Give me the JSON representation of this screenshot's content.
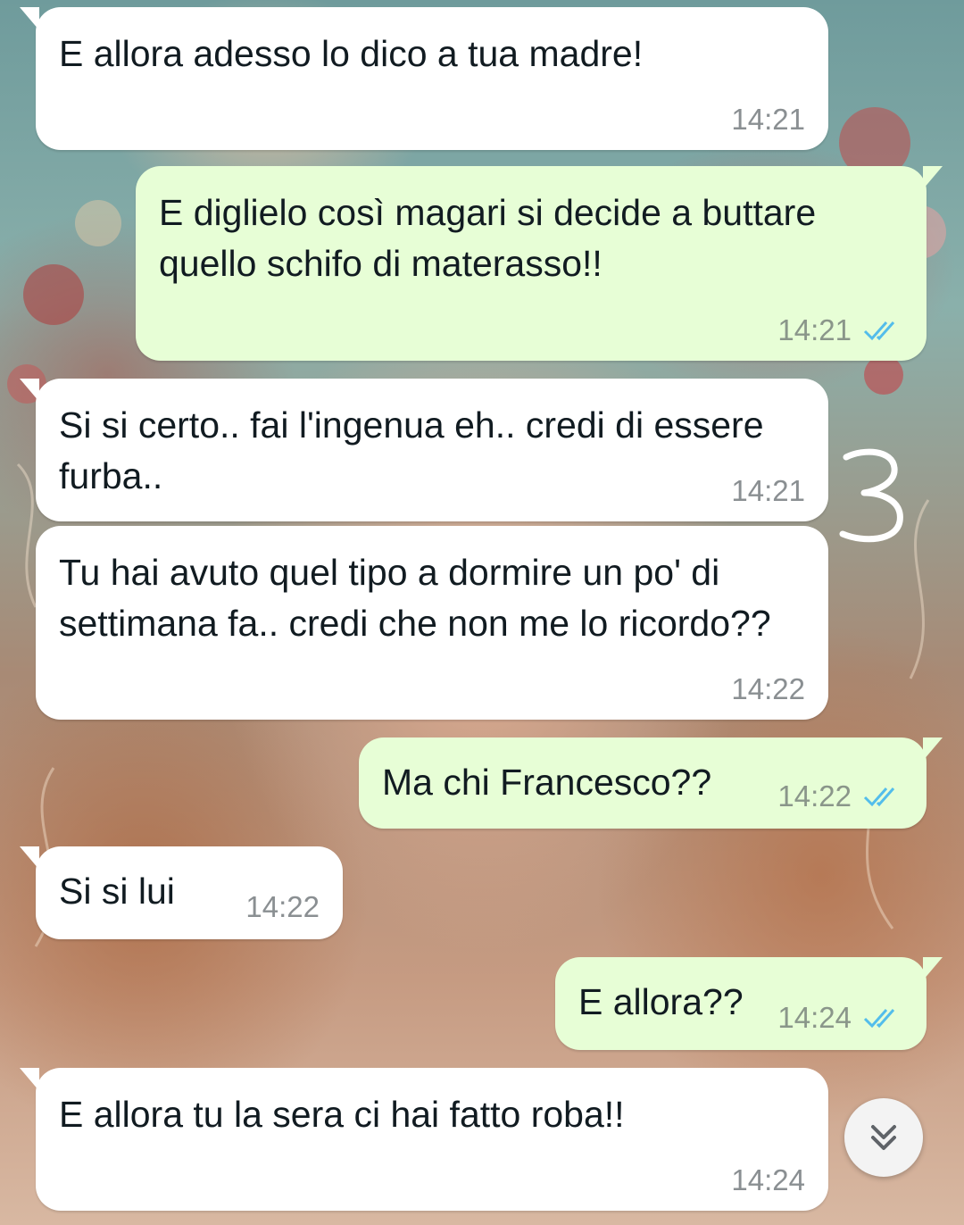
{
  "colors": {
    "incoming_bubble": "#ffffff",
    "outgoing_bubble": "#e7fed6",
    "read_receipt": "#53bdeb",
    "time_text": "#8a8f92"
  },
  "messages": [
    {
      "direction": "incoming",
      "text": "E allora adesso lo dico a tua madre!",
      "time": "14:21"
    },
    {
      "direction": "outgoing",
      "text": "E diglielo così magari si decide a buttare quello schifo di materasso!!",
      "time": "14:21",
      "status": "read"
    },
    {
      "direction": "incoming",
      "text": "Si si certo.. fai l'ingenua eh.. credi di essere furba..",
      "time": "14:21"
    },
    {
      "direction": "incoming",
      "text": "Tu hai avuto quel tipo a dormire un po' di settimana fa.. credi che non me lo ricordo??",
      "time": "14:22"
    },
    {
      "direction": "outgoing",
      "text": "Ma chi Francesco??",
      "time": "14:22",
      "status": "read"
    },
    {
      "direction": "incoming",
      "text": "Si si lui",
      "time": "14:22"
    },
    {
      "direction": "outgoing",
      "text": "E allora??",
      "time": "14:24",
      "status": "read"
    },
    {
      "direction": "incoming",
      "text": "E allora tu la sera ci hai fatto roba!!",
      "time": "14:24"
    }
  ],
  "annotation": {
    "mark": "3"
  },
  "scroll_button": {
    "icon": "double-chevron-down-icon"
  }
}
